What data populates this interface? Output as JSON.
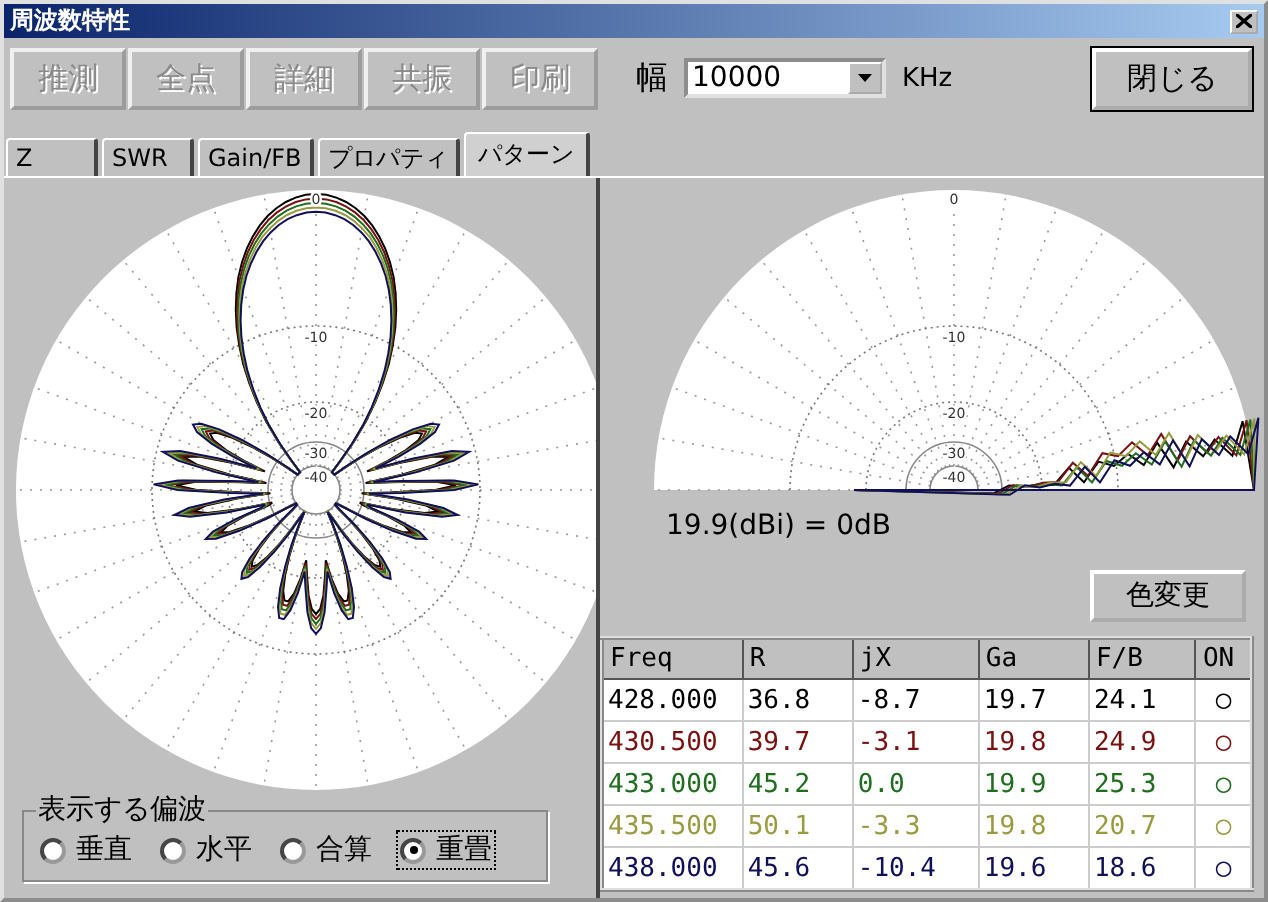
{
  "window": {
    "title": "周波数特性"
  },
  "toolbar": {
    "buttons": [
      {
        "label": "推測",
        "disabled": true
      },
      {
        "label": "全点",
        "disabled": true
      },
      {
        "label": "詳細",
        "disabled": true
      },
      {
        "label": "共振",
        "disabled": true
      },
      {
        "label": "印刷",
        "disabled": true
      }
    ],
    "width_label": "幅",
    "width_field": {
      "value": "10000"
    },
    "unit": "KHz",
    "close_button": "閉じる"
  },
  "tabs": [
    {
      "label": "Z",
      "selected": false
    },
    {
      "label": "SWR",
      "selected": false
    },
    {
      "label": "Gain/FB",
      "selected": false
    },
    {
      "label": "プロパティ",
      "selected": false
    },
    {
      "label": "パターン",
      "selected": true
    }
  ],
  "azimuth_plot": {
    "ring_labels": [
      "0",
      "-10",
      "-20",
      "-30",
      "-40"
    ]
  },
  "elevation_plot": {
    "ring_labels": [
      "0",
      "-10",
      "-20",
      "-30",
      "-40"
    ]
  },
  "gain_reference": "19.9(dBi) = 0dB",
  "color_change_button": "色変更",
  "table": {
    "columns": [
      "Freq",
      "R",
      "jX",
      "Ga",
      "F/B",
      "ON"
    ],
    "rows": [
      {
        "cells": [
          "428.000",
          "36.8",
          "-8.7",
          "19.7",
          "24.1",
          "○"
        ],
        "color": "#000000"
      },
      {
        "cells": [
          "430.500",
          "39.7",
          "-3.1",
          "19.8",
          "24.9",
          "○"
        ],
        "color": "#7a1010"
      },
      {
        "cells": [
          "433.000",
          "45.2",
          "0.0",
          "19.9",
          "25.3",
          "○"
        ],
        "color": "#1e6e1e"
      },
      {
        "cells": [
          "435.500",
          "50.1",
          "-3.3",
          "19.8",
          "20.7",
          "○"
        ],
        "color": "#9a9a40"
      },
      {
        "cells": [
          "438.000",
          "45.6",
          "-10.4",
          "19.6",
          "18.6",
          "○"
        ],
        "color": "#10105a"
      }
    ]
  },
  "polarization": {
    "legend": "表示する偏波",
    "options": [
      {
        "label": "垂直",
        "selected": false
      },
      {
        "label": "水平",
        "selected": false
      },
      {
        "label": "合算",
        "selected": false
      },
      {
        "label": "重畳",
        "selected": true
      }
    ]
  }
}
